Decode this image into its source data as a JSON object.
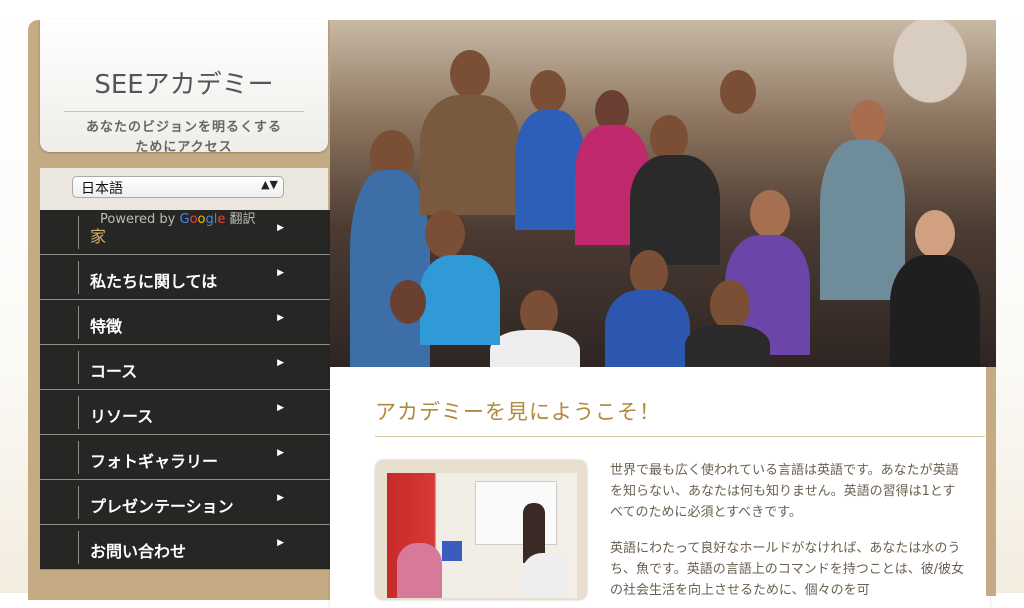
{
  "site": {
    "title": "SEEアカデミー",
    "tagline_line1": "あなたのビジョンを明るくする",
    "tagline_line2": "ためにアクセス"
  },
  "language": {
    "selected": "日本語",
    "arrows": "▲▼",
    "powered_by": "Powered by",
    "google_g1": "G",
    "google_o1": "o",
    "google_o2": "o",
    "google_g2": "g",
    "google_l": "l",
    "google_e": "e",
    "translate": "翻訳"
  },
  "nav": {
    "items": [
      {
        "label": "家",
        "active": true
      },
      {
        "label": "私たちに関しては"
      },
      {
        "label": "特徴"
      },
      {
        "label": "コース"
      },
      {
        "label": "リソース"
      },
      {
        "label": "フォトギャラリー"
      },
      {
        "label": "プレゼンテーション"
      },
      {
        "label": "お問い合わせ"
      }
    ],
    "caret": "▶"
  },
  "main": {
    "welcome": "アカデミーを見にようこそ！",
    "para1": "世界で最も広く使われている言語は英語です。あなたが英語を知らない、あなたは何も知りません。英語の習得は1とすべてのために必須とすべきです。",
    "para2": "英語にわたって良好なホールドがなければ、あなたは水のうち、魚です。英語の言語上のコマンドを持つことは、彼/彼女の社会生活を向上させるために、個々のを可"
  },
  "colors": {
    "accent_gold": "#b08a3c",
    "sidebar_tan": "#c4ab83",
    "nav_dark": "#262624"
  }
}
